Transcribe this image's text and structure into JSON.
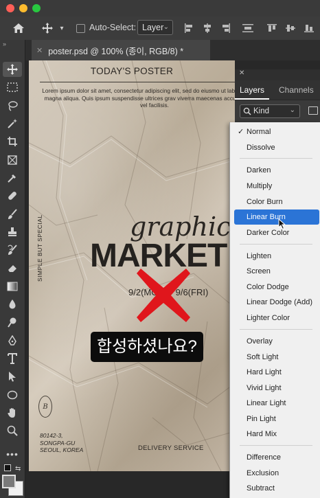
{
  "options_bar": {
    "auto_select_label": "Auto-Select:",
    "auto_select_value": "Layer"
  },
  "document_tab": {
    "title": "poster.psd @ 100% (종이, RGB/8) *"
  },
  "poster": {
    "title": "TODAY'S POSTER",
    "lorem": "Lorem ipsum dolor sit amet, consectetur adipiscing elit, sed do eiusmo ut labore et dolore magna aliqua. Quis ipsum suspendisse ultrices grav viverra maecenas accumsan lacus vel facilisis.",
    "vertical_text": "SIMPLE BUT SPECIAL",
    "script_word": "graphic",
    "headline": "MARKET",
    "dates": "9/2(MON) - 9/6(FRI)",
    "seal_letter": "B",
    "address": [
      "80142-3,",
      "SONGPA-GU",
      "SEOUL, KOREA"
    ],
    "delivery": "DELIVERY SERVICE"
  },
  "overlay_caption": "합성하셨나요?",
  "layers_panel": {
    "tabs": [
      "Layers",
      "Channels"
    ],
    "active_tab": "Layers",
    "filter_label": "Kind"
  },
  "blend_menu": {
    "checked": "Normal",
    "highlighted": "Linear Burn",
    "items": [
      "Normal",
      "Dissolve",
      "Darken",
      "Multiply",
      "Color Burn",
      "Linear Burn",
      "Darker Color",
      "Lighten",
      "Screen",
      "Color Dodge",
      "Linear Dodge (Add)",
      "Lighter Color",
      "Overlay",
      "Soft Light",
      "Hard Light",
      "Vivid Light",
      "Linear Light",
      "Pin Light",
      "Hard Mix",
      "Difference",
      "Exclusion",
      "Subtract"
    ]
  },
  "colors": {
    "accent": "#2b74d6",
    "x_mark": "#e0161c",
    "traffic_red": "#ff5f57",
    "traffic_yellow": "#febc2e",
    "traffic_green": "#28c840"
  }
}
